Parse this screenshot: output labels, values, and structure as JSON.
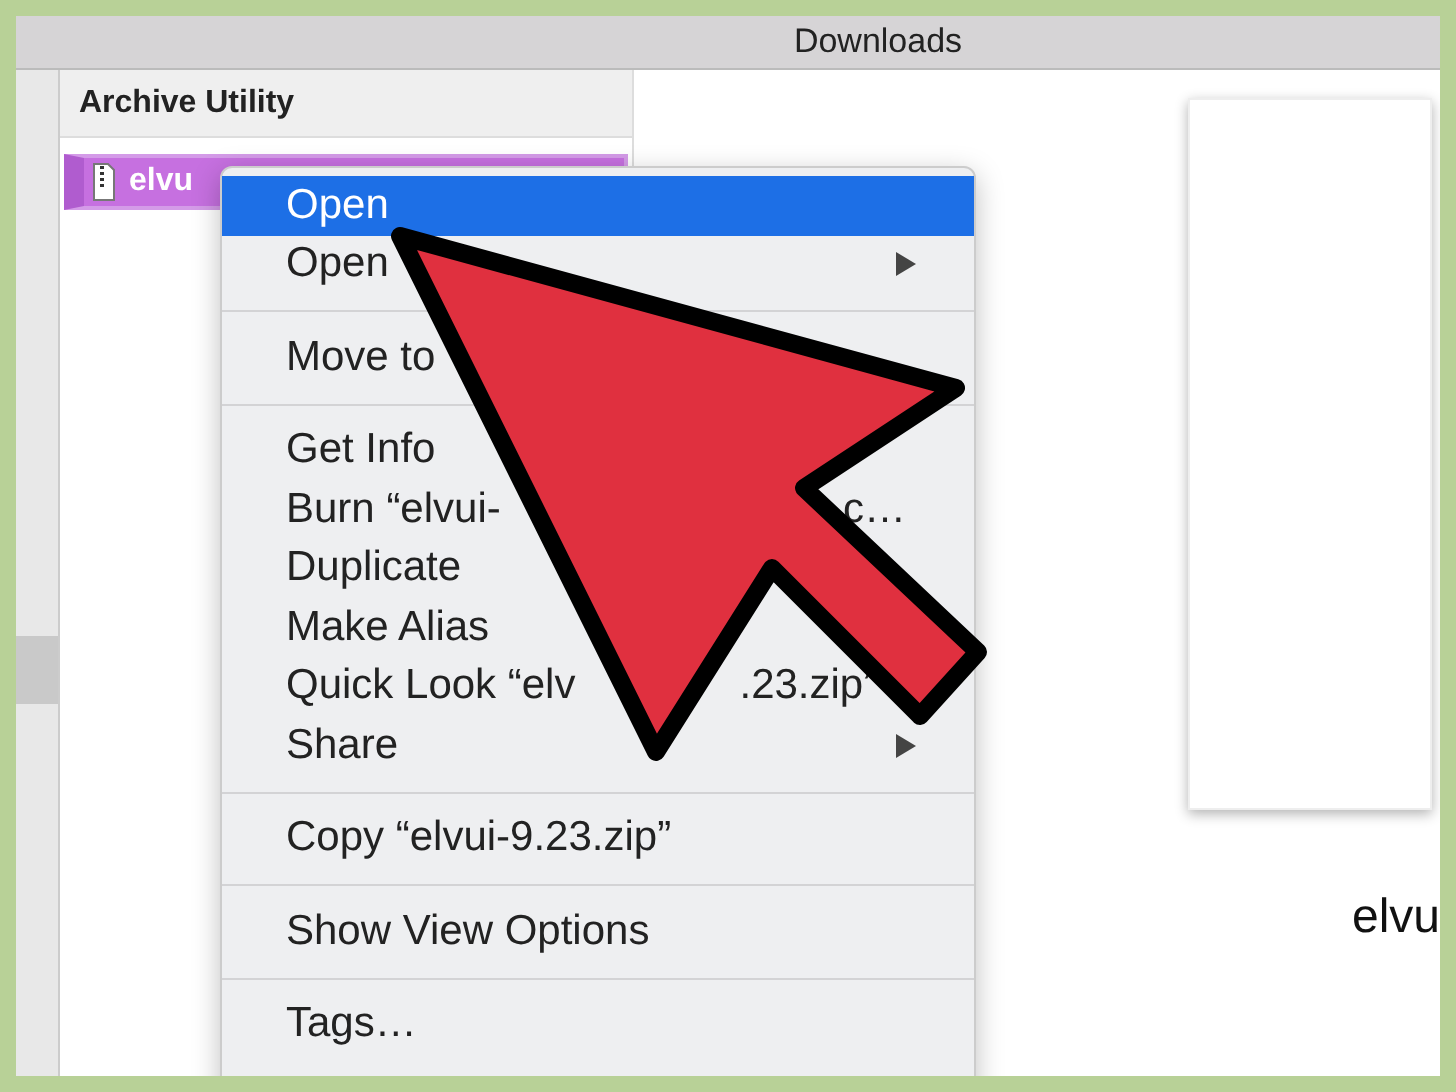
{
  "window": {
    "title": "Downloads"
  },
  "column": {
    "header": "Archive Utility",
    "files": [
      {
        "name": "elvu",
        "selected": true
      }
    ]
  },
  "preview": {
    "name": "elvu"
  },
  "context_menu": {
    "items": [
      {
        "kind": "item",
        "label": "Open",
        "selected": true,
        "submenu": false
      },
      {
        "kind": "item",
        "label": "Open",
        "selected": false,
        "submenu": true
      },
      {
        "kind": "separator"
      },
      {
        "kind": "item",
        "label": "Move to",
        "selected": false,
        "submenu": false
      },
      {
        "kind": "separator"
      },
      {
        "kind": "item",
        "label": "Get Info",
        "selected": false,
        "submenu": false
      },
      {
        "kind": "item",
        "label": "Burn “elvui-",
        "tail": "c…",
        "selected": false,
        "submenu": false
      },
      {
        "kind": "item",
        "label": "Duplicate",
        "selected": false,
        "submenu": false
      },
      {
        "kind": "item",
        "label": "Make Alias",
        "selected": false,
        "submenu": false
      },
      {
        "kind": "item",
        "label": "Quick Look “elv",
        "tail": ".23.zip”",
        "selected": false,
        "submenu": false
      },
      {
        "kind": "item",
        "label": "Share",
        "selected": false,
        "submenu": true
      },
      {
        "kind": "separator"
      },
      {
        "kind": "item",
        "label": "Copy “elvui-9.23.zip”",
        "selected": false,
        "submenu": false
      },
      {
        "kind": "separator"
      },
      {
        "kind": "item",
        "label": "Show View Options",
        "selected": false,
        "submenu": false
      },
      {
        "kind": "separator"
      },
      {
        "kind": "item",
        "label": "Tags…",
        "selected": false,
        "submenu": false
      }
    ]
  }
}
